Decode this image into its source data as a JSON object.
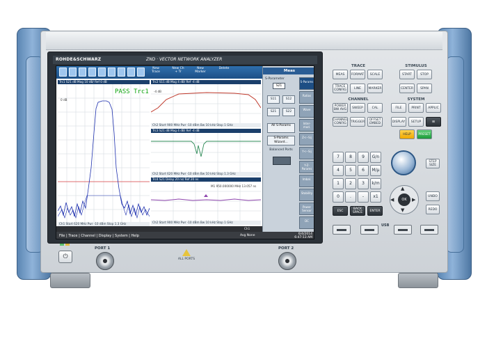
{
  "brand": {
    "logo": "ROHDE&SCHWARZ",
    "model": "ZND  ·  VECTOR NETWORK ANALYZER"
  },
  "toolbar": {
    "items": [
      {
        "label": "New Trace",
        "icon": "new-trace-icon"
      },
      {
        "label": "New Ch + Tr",
        "icon": "new-channel-icon"
      },
      {
        "label": "New Marker",
        "icon": "new-marker-icon"
      },
      {
        "label": "Delete",
        "icon": "delete-icon"
      }
    ]
  },
  "diagrams": {
    "left": {
      "title": "Trc1  S21  dB Mag  10 dB/ Ref 0 dB",
      "ref": "0 dB",
      "pass": "PASS  Trc1",
      "footer": "Ch1  Start 620 MHz   Pwr -10 dBm   Stop 1.3 GHz"
    },
    "top": {
      "title": "Trc2  S11  dB Mag  4 dB/ Ref -4 dB",
      "ref": "-4 dB",
      "footer": "Ch2  Start 900 MHz   Pwr -10 dBm   Bw 10 kHz   Stop 1 GHz"
    },
    "middle": {
      "title": "Trc3  S21  dB Mag  4 dB/ Ref -4 dB",
      "footer": "Ch2  Start 620 MHz   Pwr -10 dBm   Bw 10 kHz   Stop 1.3 GHz"
    },
    "bottom": {
      "title": "Trc4  S21  Delay  20 ns/ Ref 20 ns",
      "marker": "M1  950.000000 MHz  13.057 ns",
      "footer": "Ch2  Start 900 MHz   Pwr -10 dBm   Bw 10 kHz   Stop 1 GHz"
    }
  },
  "sidepanel": {
    "title": "Meas",
    "param_label": "S-Parameter",
    "param_value": "S21",
    "sparams": [
      "S11",
      "S12",
      "S21",
      "S22"
    ],
    "all_sparams": "All S-Params",
    "wizard": "S-Params Wizard...",
    "balanced": "Balanced Ports",
    "tabs": [
      "S-Params",
      "Ratios",
      "Wave",
      "Inter-mod.",
      "Z<--Sij",
      "Y<--Sij",
      "Y-Z-Params",
      "Imbal.",
      "Stability",
      "Power Sensor",
      "DC"
    ]
  },
  "statusbar": {
    "ch": "Ch1",
    "avg": "Avg None"
  },
  "menubar": {
    "items": "File | Trace | Channel | Display | System | Help",
    "date": "6/4/2014",
    "time": "6:47:13 AM"
  },
  "controls": {
    "trace": {
      "label": "TRACE",
      "keys": [
        "MEAS",
        "FORMAT",
        "SCALE",
        "TRACE CONFIG",
        "LINE",
        "MARKER"
      ]
    },
    "channel": {
      "label": "CHANNEL",
      "keys": [
        "POWER BW AVG",
        "SWEEP",
        "CAL",
        "CHANNEL CONFIG",
        "TRIGGER",
        "OFFSET EMBED"
      ]
    },
    "stimulus": {
      "label": "STIMULUS",
      "keys": [
        "START",
        "STOP",
        "CENTER",
        "SPAN"
      ]
    },
    "system": {
      "label": "SYSTEM",
      "keys": [
        "FILE",
        "PRINT",
        "APPLIC",
        "DISPLAY",
        "SETUP",
        "HELP",
        "PRESET"
      ]
    },
    "numpad": [
      "7",
      "8",
      "9",
      "G/n",
      "4",
      "5",
      "6",
      "M/μ",
      "1",
      "2",
      "3",
      "k/m",
      "0",
      ".",
      "-",
      "x1"
    ],
    "bottom_keys": [
      "ESC",
      "BACK SPACE",
      "ENTER"
    ],
    "step_size": "STEP SIZE",
    "nav": {
      "ok": "OK",
      "undo": "UNDO",
      "redo": "REDO"
    },
    "usb": "USB"
  },
  "ports": {
    "port1": "PORT 1",
    "port2": "PORT 2",
    "warning": "ALL PORTS"
  }
}
